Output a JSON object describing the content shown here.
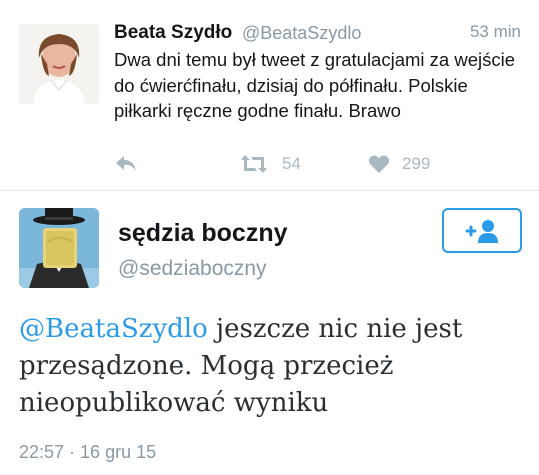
{
  "quoted_tweet": {
    "author_name": "Beata Szydło",
    "author_handle": "@BeataSzydlo",
    "time_ago": "53 min",
    "text": "Dwa dni temu był tweet z gratulacjami za wejście do ćwierćfinału, dzisiaj do półfinału. Polskie piłkarki ręczne godne finału. Brawo",
    "retweet_count": "54",
    "like_count": "299",
    "icons": [
      "reply-icon",
      "retweet-icon",
      "heart-icon"
    ]
  },
  "main_tweet": {
    "author_name": "sędzia boczny",
    "author_handle": "@sedziaboczny",
    "mention": "@BeataSzydlo",
    "text": " jeszcze nic nie jest przesądzone. Mogą przecież nieopublikować wyniku",
    "timestamp": "22:57 · 16 gru 15",
    "follow_icon": "add-user-icon"
  },
  "colors": {
    "accent": "#2b9ae8",
    "muted": "#8899a6",
    "action_icon": "#aab8c2",
    "text": "#14171a"
  }
}
